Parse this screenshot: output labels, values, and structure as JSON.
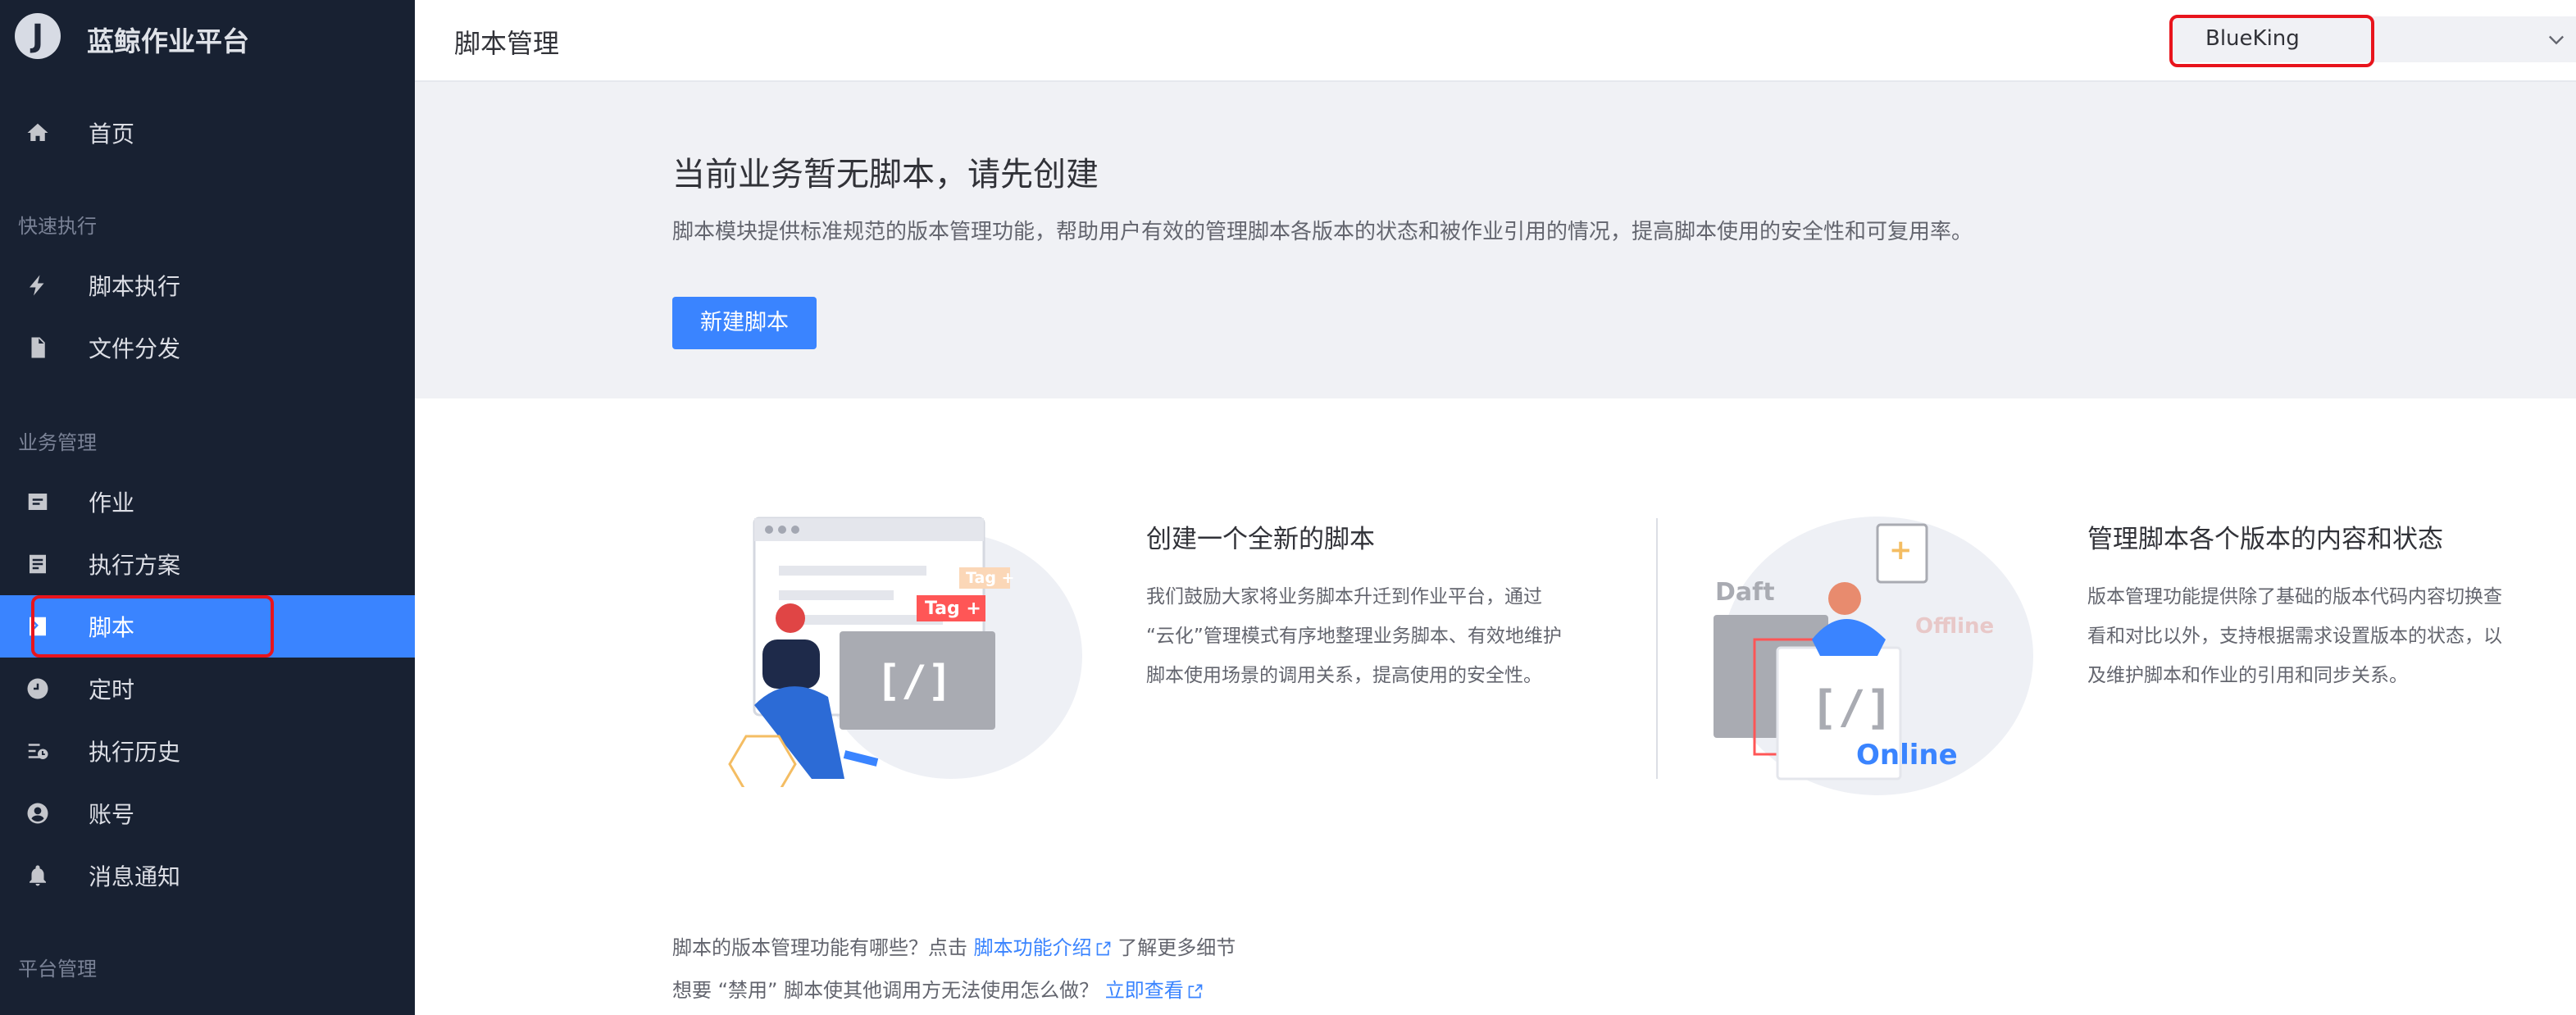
{
  "brand": {
    "logo_letter": "J",
    "name": "蓝鲸作业平台"
  },
  "sidebar": {
    "home": {
      "label": "首页",
      "icon": "home-icon"
    },
    "groups": {
      "quick_exec": "快速执行",
      "business": "业务管理",
      "platform": "平台管理"
    },
    "quick_items": [
      {
        "label": "脚本执行",
        "icon": "script-execute-icon"
      },
      {
        "label": "文件分发",
        "icon": "file-distribute-icon"
      }
    ],
    "business_items": [
      {
        "label": "作业",
        "icon": "job-icon"
      },
      {
        "label": "执行方案",
        "icon": "plan-icon"
      },
      {
        "label": "脚本",
        "icon": "script-icon",
        "active": true
      },
      {
        "label": "定时",
        "icon": "clock-icon"
      },
      {
        "label": "执行历史",
        "icon": "history-icon"
      },
      {
        "label": "账号",
        "icon": "account-icon"
      },
      {
        "label": "消息通知",
        "icon": "bell-icon"
      }
    ]
  },
  "header": {
    "title": "脚本管理",
    "business_select": {
      "value": "BlueKing"
    }
  },
  "banner": {
    "title": "当前业务暂无脚本，请先创建",
    "description": "脚本模块提供标准规范的版本管理功能，帮助用户有效的管理脚本各版本的状态和被作业引用的情况，提高脚本使用的安全性和可复用率。",
    "create_button": "新建脚本"
  },
  "features": [
    {
      "title": "创建一个全新的脚本",
      "desc_lines": [
        "我们鼓励大家将业务脚本升迁到作业平台，通过",
        "“云化”管理模式有序地整理业务脚本、有效地维护",
        "脚本使用场景的调用关系，提高使用的安全性。"
      ],
      "illustration_text": {
        "tag1": "Tag +",
        "tag2": "Tag +",
        "code": "[/]"
      }
    },
    {
      "title": "管理脚本各个版本的内容和状态",
      "desc_lines": [
        "版本管理功能提供除了基础的版本代码内容切换查",
        "看和对比以外，支持根据需求设置版本的状态，以",
        "及维护脚本和作业的引用和同步关系。"
      ],
      "illustration_text": {
        "draft": "Daft",
        "offline": "Offline",
        "online": "Online",
        "code": "[/]"
      }
    }
  ],
  "footer": {
    "line1_prefix": "脚本的版本管理功能有哪些？点击 ",
    "line1_link": "脚本功能介绍",
    "line1_suffix": " 了解更多细节",
    "line2_prefix": "想要 “禁用” 脚本使其他调用方无法使用怎么做？ ",
    "line2_link": "立即查看"
  },
  "colors": {
    "primary": "#3a84ff",
    "sidebar_bg": "#182132",
    "highlight": "#e8141c"
  }
}
